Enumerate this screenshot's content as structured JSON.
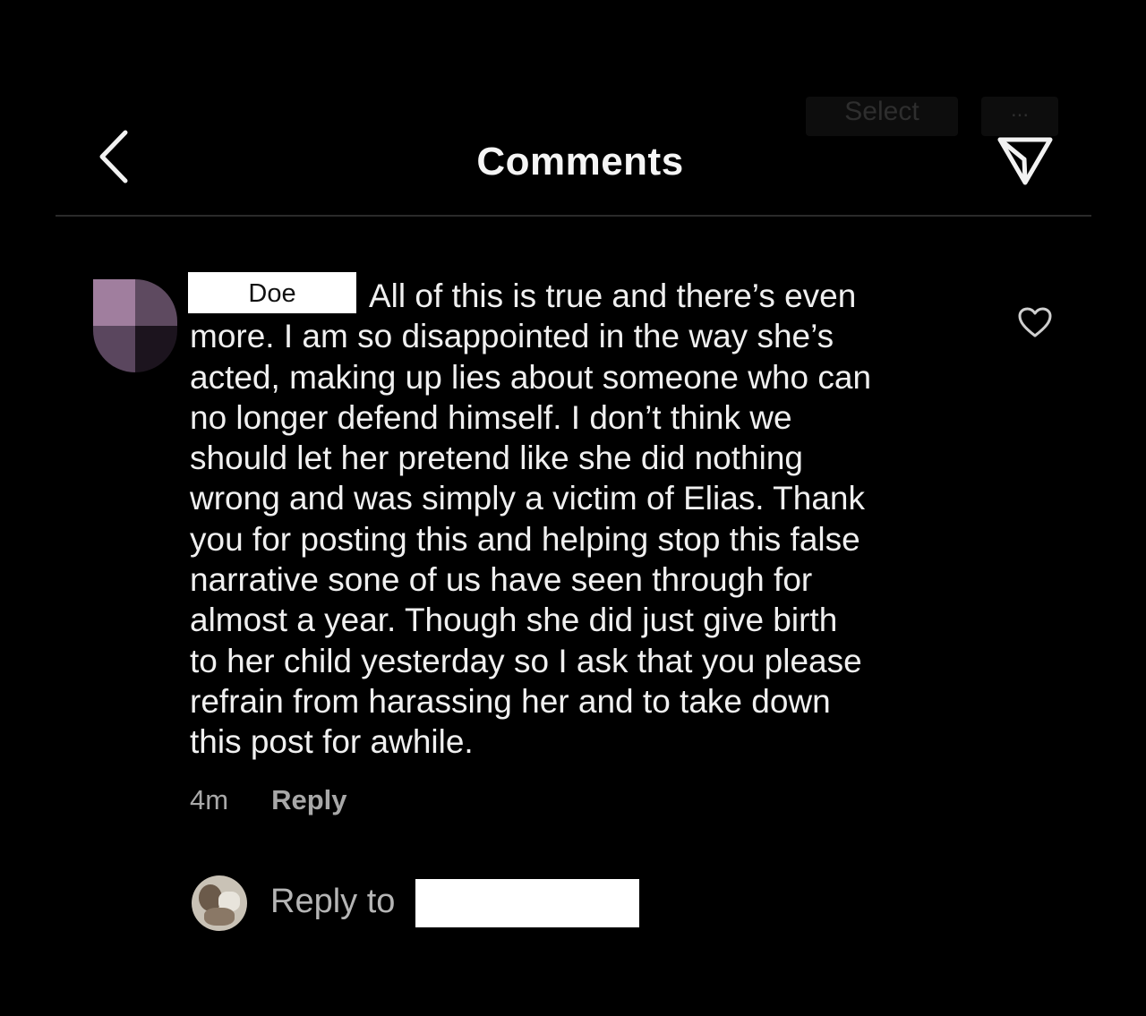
{
  "header": {
    "title": "Comments",
    "ghost_select": "Select",
    "ghost_more": "..."
  },
  "comment": {
    "username": "Doe",
    "lines": [
      "All of this is true and there’s even",
      "more.  I am so disappointed in the way she’s",
      "acted, making up lies about someone who can",
      "no longer defend himself.  I don’t think we",
      "should let her pretend like she did nothing",
      "wrong and was simply a victim of Elias.  Thank",
      "you for posting this and helping stop this false",
      "narrative sone of us have seen through for",
      "almost a year.  Though she did just give birth",
      "to her child yesterday so I ask that you please",
      "refrain from harassing her and to take down",
      "this post for awhile."
    ],
    "time": "4m",
    "reply_label": "Reply",
    "avatar_colors": [
      "#a07e9e",
      "#5e4a60",
      "#5a465e",
      "#1c141e"
    ]
  },
  "reply_bar": {
    "label": "Reply to"
  },
  "icons": {
    "back": "chevron-left-icon",
    "share": "paper-plane-icon",
    "like": "heart-icon"
  }
}
